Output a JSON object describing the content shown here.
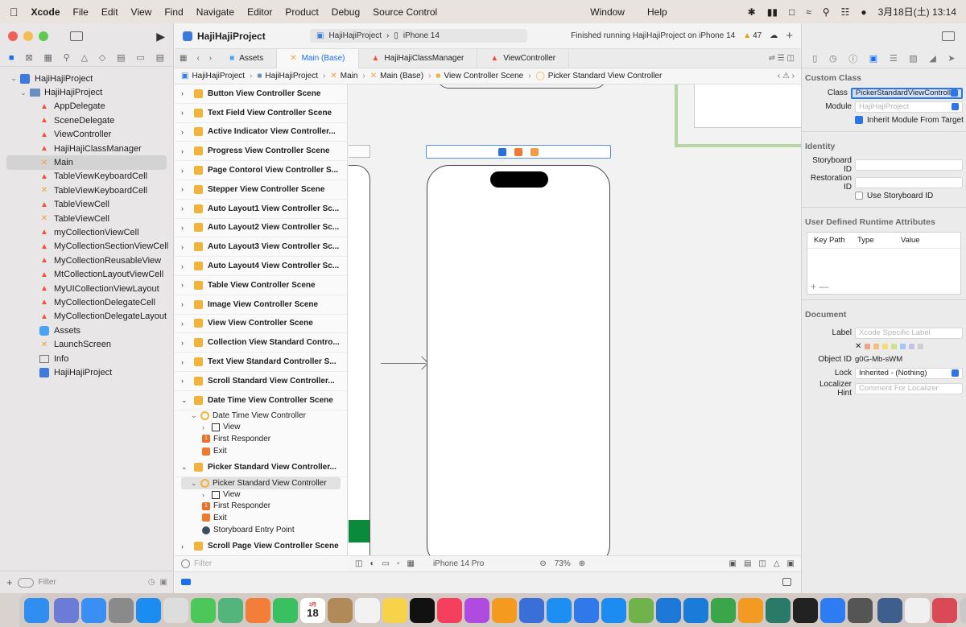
{
  "menubar": {
    "app": "Xcode",
    "items": [
      "File",
      "Edit",
      "View",
      "Find",
      "Navigate",
      "Editor",
      "Product",
      "Debug",
      "Source Control",
      "Window",
      "Help"
    ],
    "datetime": "3月18日(土) 13:14"
  },
  "toolbar": {
    "project_name": "HajiHajiProject",
    "scheme": "HajiHajiProject",
    "device": "iPhone 14",
    "status": "Finished running HajiHajiProject on iPhone 14",
    "warnings": "47"
  },
  "navigator": {
    "items": [
      {
        "label": "HajiHajiProject",
        "kind": "project",
        "indent": 0,
        "chevron": "⌄"
      },
      {
        "label": "HajiHajiProject",
        "kind": "folder",
        "indent": 1,
        "chevron": "⌄"
      },
      {
        "label": "AppDelegate",
        "kind": "swift",
        "indent": 2
      },
      {
        "label": "SceneDelegate",
        "kind": "swift",
        "indent": 2
      },
      {
        "label": "ViewController",
        "kind": "swift",
        "indent": 2
      },
      {
        "label": "HajiHajiClassManager",
        "kind": "swift",
        "indent": 2
      },
      {
        "label": "Main",
        "kind": "ib",
        "indent": 2,
        "selected": true
      },
      {
        "label": "TableViewKeyboardCell",
        "kind": "swift",
        "indent": 2
      },
      {
        "label": "TableViewKeyboardCell",
        "kind": "ib",
        "indent": 2
      },
      {
        "label": "TableViewCell",
        "kind": "swift",
        "indent": 2
      },
      {
        "label": "TableViewCell",
        "kind": "ib",
        "indent": 2
      },
      {
        "label": "myCollectionViewCell",
        "kind": "swift",
        "indent": 2
      },
      {
        "label": "MyCollectionSectionViewCell",
        "kind": "swift",
        "indent": 2
      },
      {
        "label": "MyCollectionReusableView",
        "kind": "swift",
        "indent": 2
      },
      {
        "label": "MtCollectionLayoutViewCell",
        "kind": "swift",
        "indent": 2
      },
      {
        "label": "MyUICollectionViewLayout",
        "kind": "swift",
        "indent": 2
      },
      {
        "label": "MyCollectionDelegateCell",
        "kind": "swift",
        "indent": 2
      },
      {
        "label": "MyCollectionDelegateLayout",
        "kind": "swift",
        "indent": 2
      },
      {
        "label": "Assets",
        "kind": "assets",
        "indent": 2
      },
      {
        "label": "LaunchScreen",
        "kind": "ib",
        "indent": 2
      },
      {
        "label": "Info",
        "kind": "info",
        "indent": 2
      },
      {
        "label": "HajiHajiProject",
        "kind": "proj2",
        "indent": 2
      }
    ],
    "filter_placeholder": "Filter"
  },
  "tabs": [
    {
      "label": "Assets",
      "active": false
    },
    {
      "label": "Main (Base)",
      "active": true
    },
    {
      "label": "HajiHajiClassManager",
      "active": false
    },
    {
      "label": "ViewController",
      "active": false
    }
  ],
  "jumpbar": [
    "HajiHajiProject",
    "HajiHajiProject",
    "Main",
    "Main (Base)",
    "View Controller Scene",
    "Picker Standard View Controller"
  ],
  "outline": {
    "scenes": [
      {
        "label": "Button View Controller Scene"
      },
      {
        "label": "Text Field View Controller Scene"
      },
      {
        "label": "Active Indicator View Controller..."
      },
      {
        "label": "Progress View Controller Scene"
      },
      {
        "label": "Page Contorol View Controller S..."
      },
      {
        "label": "Stepper View Controller Scene"
      },
      {
        "label": "Auto Layout1 View Controller Sc..."
      },
      {
        "label": "Auto Layout2 View Controller Sc..."
      },
      {
        "label": "Auto Layout3 View Controller Sc..."
      },
      {
        "label": "Auto Layout4 View Controller Sc..."
      },
      {
        "label": "Table View Controller Scene"
      },
      {
        "label": "Image View Controller Scene"
      },
      {
        "label": "View View Controller Scene"
      },
      {
        "label": "Collection View Standard Contro..."
      },
      {
        "label": "Text View Standard Controller S..."
      },
      {
        "label": "Scroll Standard View Controller..."
      }
    ],
    "datetime_scene": {
      "label": "Date Time View Controller Scene",
      "controller": "Date Time View Controller",
      "view": "View",
      "first_responder": "First Responder",
      "exit": "Exit"
    },
    "picker_scene": {
      "label": "Picker Standard View Controller...",
      "controller": "Picker Standard View Controller",
      "view": "View",
      "first_responder": "First Responder",
      "exit": "Exit",
      "entry_point": "Storyboard Entry Point"
    },
    "last_scene": "Scroll Page View Controller Scene",
    "filter_placeholder": "Filter"
  },
  "canvas": {
    "device": "iPhone 14 Pro",
    "zoom": "73%"
  },
  "inspector": {
    "custom_class_title": "Custom Class",
    "class_label": "Class",
    "class_value": "PickerStandardViewControll",
    "module_label": "Module",
    "module_placeholder": "HajiHajiProject",
    "inherit_label": "Inherit Module From Target",
    "identity_title": "Identity",
    "storyboard_id_label": "Storyboard ID",
    "restoration_id_label": "Restoration ID",
    "use_storyboard_label": "Use Storyboard ID",
    "udra_title": "User Defined Runtime Attributes",
    "udra_cols": [
      "Key Path",
      "Type",
      "Value"
    ],
    "document_title": "Document",
    "label_label": "Label",
    "label_placeholder": "Xcode Specific Label",
    "object_id_label": "Object ID",
    "object_id_value": "g0G-Mb-sWM",
    "lock_label": "Lock",
    "lock_value": "Inherited - (Nothing)",
    "localizer_label": "Localizer Hint",
    "localizer_placeholder": "Comment For Localizer",
    "swatch_colors": [
      "#f0a38a",
      "#f4bd7a",
      "#f3dc7a",
      "#cfe08e",
      "#9ec8f3",
      "#c9c0e8",
      "#cfcfcf"
    ]
  },
  "dock": {
    "calendar_month": "3月",
    "calendar_day": "18",
    "apps": [
      {
        "color": "#2f8ef0"
      },
      {
        "color": "#6c7bd6"
      },
      {
        "color": "#3a8ff5"
      },
      {
        "color": "#8a8a8a"
      },
      {
        "color": "#1b8cf0"
      },
      {
        "color": "#dddddd"
      },
      {
        "color": "#4cc85a"
      },
      {
        "color": "#53b47c"
      },
      {
        "color": "#f27e3a"
      },
      {
        "color": "#39c061"
      },
      {
        "color": "#ffffff"
      },
      {
        "color": "#b08a57"
      },
      {
        "color": "#f2f2f2"
      },
      {
        "color": "#f7d34a"
      },
      {
        "color": "#111111"
      },
      {
        "color": "#f4405d"
      },
      {
        "color": "#b04be0"
      },
      {
        "color": "#f39a1f"
      },
      {
        "color": "#3b6fd8"
      },
      {
        "color": "#1e8ff2"
      },
      {
        "color": "#2f79ea"
      },
      {
        "color": "#1d8cf2"
      },
      {
        "color": "#6fb34a"
      },
      {
        "color": "#1e78d8"
      },
      {
        "color": "#1b7bd8"
      },
      {
        "color": "#3ba54a"
      },
      {
        "color": "#f39a22"
      },
      {
        "color": "#2a7a6a"
      },
      {
        "color": "#222222"
      },
      {
        "color": "#2e7cf1"
      },
      {
        "color": "#555555"
      },
      {
        "color": "#3e5e8e"
      },
      {
        "color": "#f0f0f0"
      },
      {
        "color": "#d94a56"
      },
      {
        "color": "#c9c9c9"
      }
    ]
  }
}
